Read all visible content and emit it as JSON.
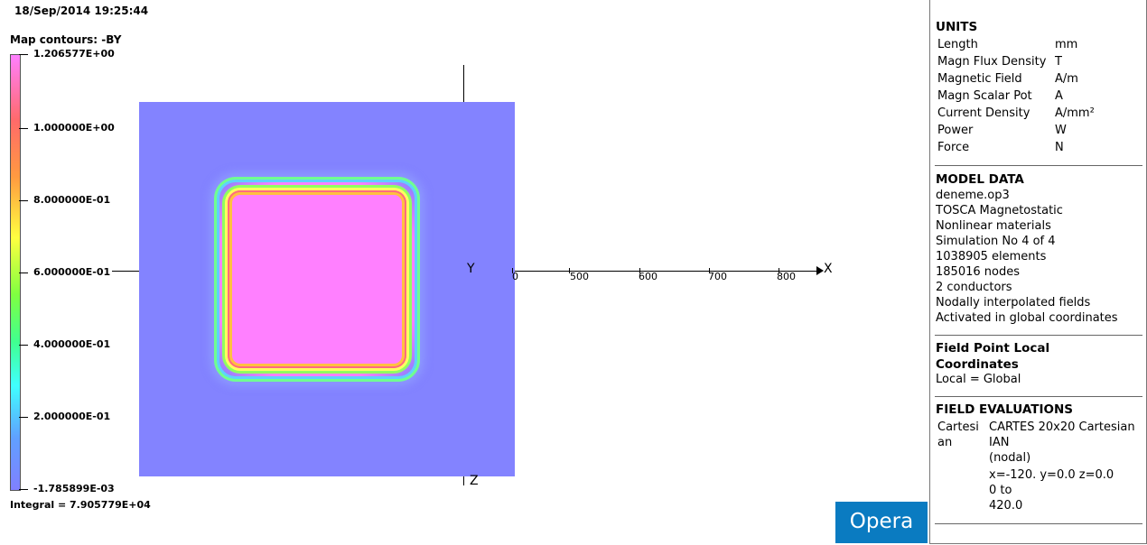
{
  "header": {
    "timestamp": "18/Sep/2014 19:25:44",
    "map_title": "Map contours: -BY"
  },
  "legend": {
    "ticks": [
      "1.206577E+00",
      "1.000000E+00",
      "8.000000E-01",
      "6.000000E-01",
      "4.000000E-01",
      "2.000000E-01",
      "-1.785899E-03"
    ],
    "integral": "Integral = 7.905779E+04"
  },
  "axes": {
    "x_label": "X",
    "y_label": "Y",
    "z_label": "Z",
    "x_ticks": [
      "0",
      "500",
      "600",
      "700",
      "800"
    ]
  },
  "panel": {
    "units_title": "UNITS",
    "units": [
      {
        "name": "Length",
        "unit": "mm"
      },
      {
        "name": "Magn Flux Density",
        "unit": "T"
      },
      {
        "name": "Magnetic Field",
        "unit": "A/m"
      },
      {
        "name": "Magn Scalar Pot",
        "unit": "A"
      },
      {
        "name": "Current Density",
        "unit": "A/mm²"
      },
      {
        "name": "Power",
        "unit": "W"
      },
      {
        "name": "Force",
        "unit": "N"
      }
    ],
    "model_title": "MODEL DATA",
    "model_lines": [
      "deneme.op3",
      "TOSCA Magnetostatic",
      "Nonlinear materials",
      "Simulation No 4 of 4",
      "1038905 elements",
      "185016 nodes",
      "2 conductors",
      "Nodally interpolated fields",
      "Activated in global coordinates"
    ],
    "fp_title_1": "Field Point Local",
    "fp_title_2": "Coordinates",
    "fp_value": "Local = Global",
    "fe_title": "FIELD EVALUATIONS",
    "fe_col1": [
      "Cartesi",
      "an"
    ],
    "fe_col2": [
      "CARTES 20x20 Cartesian",
      "IAN",
      "(nodal)",
      "x=-120. y=0.0  z=0.0",
      "0 to",
      "420.0"
    ]
  },
  "logo": {
    "text": "Opera"
  }
}
